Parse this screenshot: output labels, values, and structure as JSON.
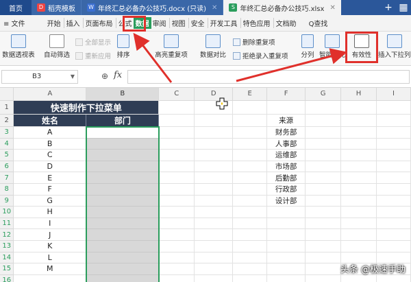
{
  "tabs": [
    {
      "label": "首页"
    },
    {
      "label": "稻壳模板"
    },
    {
      "label": "年终汇总必备办公技巧.docx (只读)"
    },
    {
      "label": "年终汇总必备办公技巧.xlsx"
    }
  ],
  "window_controls": {
    "add": "+",
    "layout": "▦"
  },
  "menu": {
    "file": "≡ 文件",
    "items": [
      "开始",
      "插入",
      "页面布局",
      "公式",
      "数据",
      "审阅",
      "视图",
      "安全",
      "开发工具",
      "特色应用",
      "文档助"
    ],
    "search": "Q查找"
  },
  "ribbon": {
    "pivot": "数据透视表",
    "autofilter": "自动筛选",
    "show_all": "全部显示",
    "reapply": "重新应用",
    "sort": "排序",
    "highlight_dup": "高亮重复项",
    "compare": "数据对比",
    "remove_dup": "删除重复项",
    "reject_dup": "拒绝录入重复项",
    "split": "分列",
    "smart_fill": "智能填充",
    "validity": "有效性",
    "insert_dropdown": "插入下拉列表"
  },
  "formula_bar": {
    "cell_ref": "B3",
    "fx": "fx",
    "value": ""
  },
  "columns": [
    "A",
    "B",
    "C",
    "D",
    "E",
    "F",
    "G",
    "H",
    "I"
  ],
  "rows": [
    "1",
    "2",
    "3",
    "4",
    "5",
    "6",
    "7",
    "8",
    "9",
    "10",
    "11",
    "12",
    "13",
    "14",
    "15",
    "16"
  ],
  "sheet": {
    "title": "快速制作下拉菜单",
    "header_name": "姓名",
    "header_dept": "部门",
    "names": [
      "A",
      "B",
      "C",
      "D",
      "E",
      "F",
      "G",
      "H",
      "I",
      "J",
      "K",
      "L",
      "M",
      ""
    ],
    "source_label": "来源",
    "sources": [
      "财务部",
      "人事部",
      "运维部",
      "市场部",
      "后勤部",
      "行政部",
      "设计部"
    ]
  },
  "accent_colors": {
    "data_tab": "#2a9d5c",
    "annotation": "#e0302b",
    "header_fill": "#2f3d55"
  },
  "watermark": "头条 @极速手助"
}
